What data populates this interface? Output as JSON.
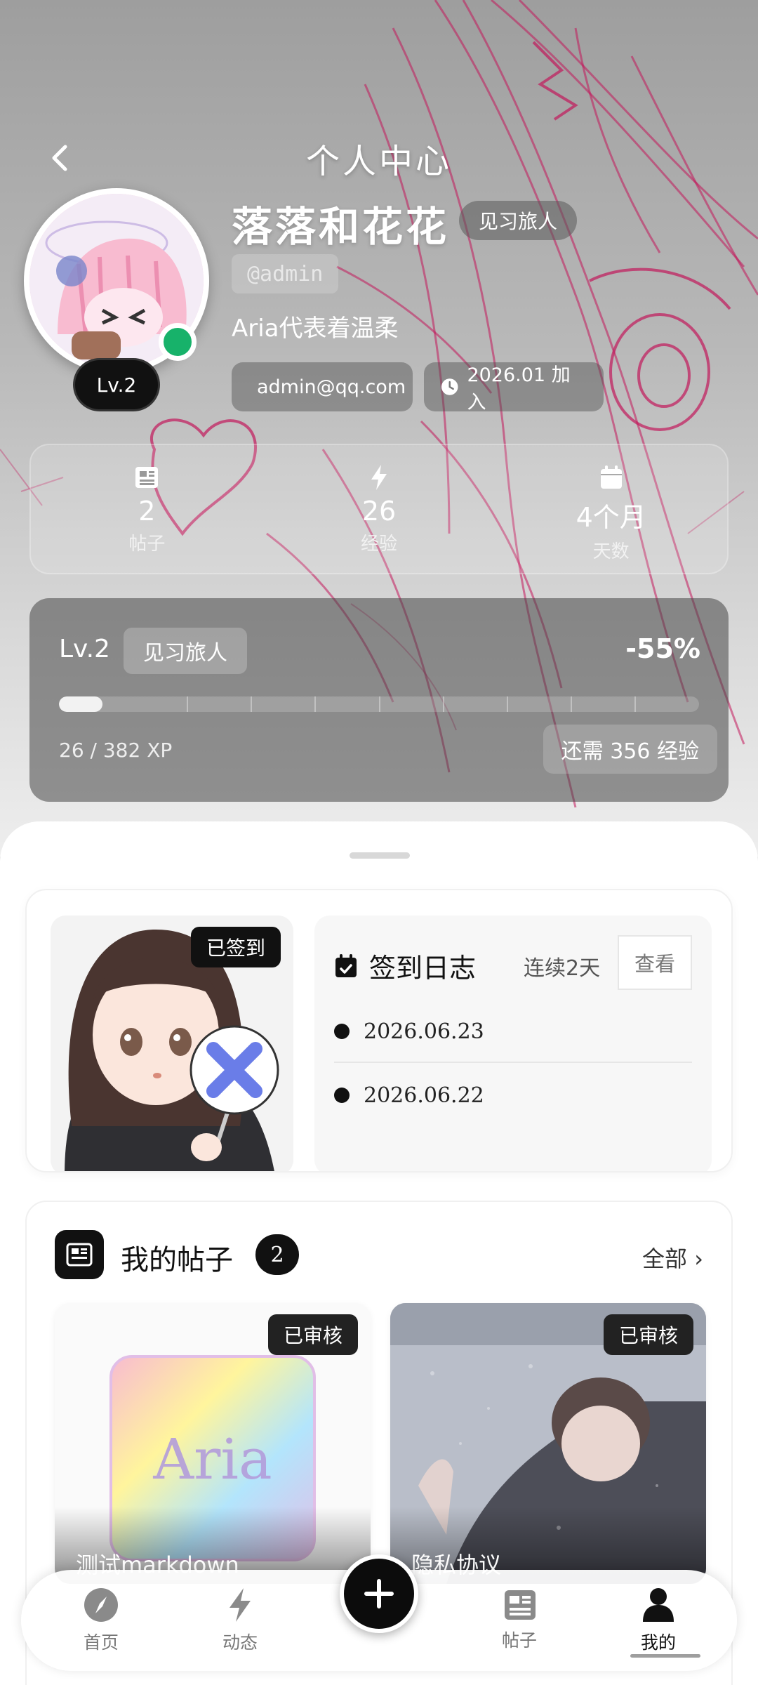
{
  "header": {
    "title": "个人中心",
    "back_icon": "chevron-left-icon"
  },
  "profile": {
    "username": "落落和花花",
    "title_badge": "见习旅人",
    "handle": "@admin",
    "bio": "Aria代表着温柔",
    "avatar_level": "Lv.2",
    "email": "admin@qq.com",
    "joined": "2026.01 加入",
    "online_color": "#17b26a"
  },
  "stats": [
    {
      "icon": "newspaper-icon",
      "value": "2",
      "label": "帖子"
    },
    {
      "icon": "lightning-icon",
      "value": "26",
      "label": "经验"
    },
    {
      "icon": "calendar-icon",
      "value": "4个月",
      "label": "天数"
    }
  ],
  "level": {
    "level": "Lv.2",
    "rank": "见习旅人",
    "percent": "-55%",
    "xp_text": "26 / 382 XP",
    "need_text": "还需 356 经验",
    "progress_fraction": 0.068
  },
  "checkin": {
    "signed_badge": "已签到",
    "log_title": "签到日志",
    "streak": "连续2天",
    "view_button": "查看",
    "entries": [
      "2026.06.23",
      "2026.06.22"
    ]
  },
  "posts": {
    "title": "我的帖子",
    "count": "2",
    "all_link": "全部 ›",
    "items": [
      {
        "status": "已审核",
        "title": "测试markdown"
      },
      {
        "status": "已审核",
        "title": "隐私协议"
      }
    ]
  },
  "nav": {
    "items": [
      {
        "label": "首页",
        "icon": "compass-icon"
      },
      {
        "label": "动态",
        "icon": "lightning-icon"
      },
      {
        "label": "帖子",
        "icon": "newspaper-icon"
      },
      {
        "label": "我的",
        "icon": "user-icon"
      }
    ],
    "fab_icon": "plus-icon",
    "active": "我的"
  },
  "colors": {
    "accent": "#111111",
    "sketch": "#c2185b"
  }
}
